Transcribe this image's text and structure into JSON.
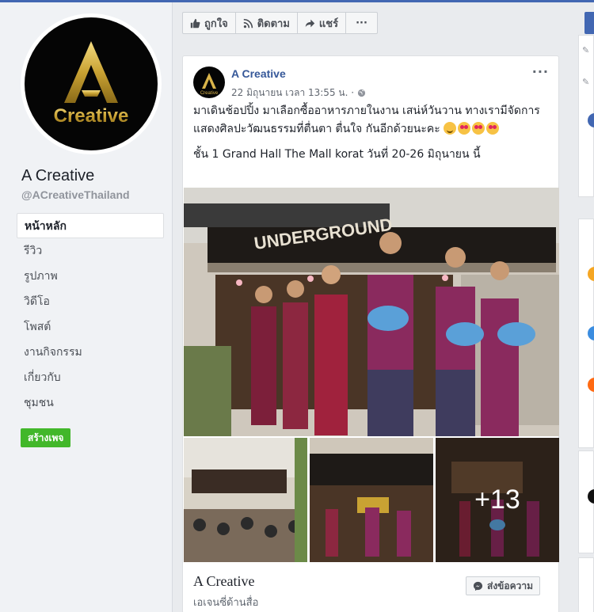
{
  "page": {
    "name": "A Creative",
    "handle": "@ACreativeThailand",
    "logo_text": "Creative",
    "logo_letter": "A"
  },
  "nav": {
    "items": [
      {
        "label": "หน้าหลัก",
        "active": true
      },
      {
        "label": "รีวิว"
      },
      {
        "label": "รูปภาพ"
      },
      {
        "label": "วิดีโอ"
      },
      {
        "label": "โพสต์"
      },
      {
        "label": "งานกิจกรรม"
      },
      {
        "label": "เกี่ยวกับ"
      },
      {
        "label": "ชุมชน"
      }
    ],
    "create_page": "สร้างเพจ"
  },
  "actions": {
    "like": "ถูกใจ",
    "follow": "ติดตาม",
    "share": "แชร์",
    "more": "···"
  },
  "post": {
    "author": "A Creative",
    "timestamp": "22 มิถุนายน เวลา 13:55 น. ·",
    "more": "···",
    "text_line1": "มาเดินช้อปปิ้ง มาเลือกซื้ออาหารภายในงาน เสน่ห์วันวาน ทางเรามีจัดการแสดงศิลปะวัฒนธรรมที่ตื่นตา ตื่นใจ กันอีกด้วยนะคะ",
    "text_line2": "ชั้น 1 Grand Hall The Mall korat วันที่ 20-26 มิถุนายน นี้",
    "photo_banner": "UNDERGROUND",
    "more_photos": "+13",
    "footer_name": "A Creative",
    "footer_sub": "เอเจนซี่ด้านสื่อ",
    "message_button": "ส่งข้อความ"
  },
  "colors": {
    "brand_blue": "#4267b2",
    "link_blue": "#365899",
    "green": "#42b72a",
    "gold": "#c9a233"
  }
}
